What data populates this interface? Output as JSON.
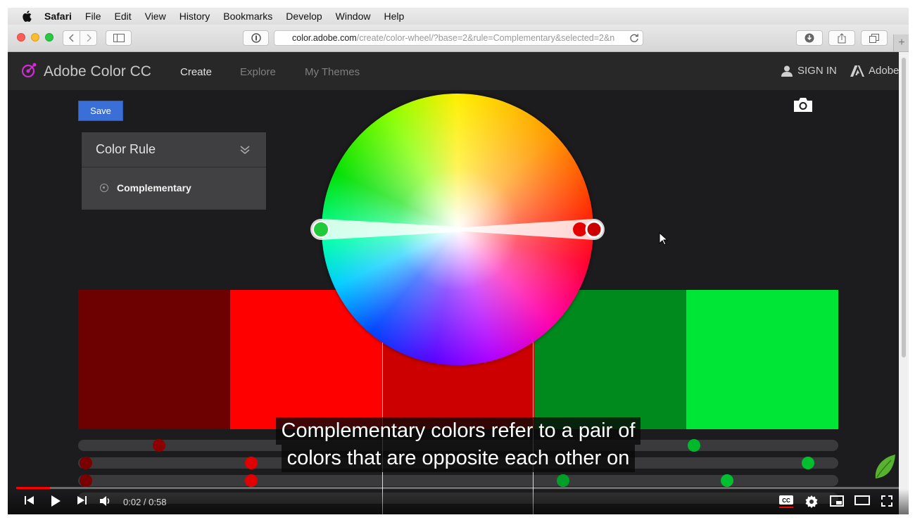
{
  "menubar": {
    "items": [
      "Safari",
      "File",
      "Edit",
      "View",
      "History",
      "Bookmarks",
      "Develop",
      "Window",
      "Help"
    ]
  },
  "browser": {
    "url_domain": "color.adobe.com",
    "url_path": "/create/color-wheel/?base=2&rule=Complementary&selected=2&n"
  },
  "app": {
    "brand": "Adobe Color CC",
    "nav": [
      "Create",
      "Explore",
      "My Themes"
    ],
    "sign_in": "SIGN IN",
    "adobe": "Adobe"
  },
  "toolbar": {
    "save_label": "Save"
  },
  "color_rule": {
    "title": "Color Rule",
    "selected": "Complementary"
  },
  "swatches": [
    "#6d0000",
    "#ff0000",
    "#cc0000",
    "#008a1e",
    "#00e637"
  ],
  "slider_knobs": [
    {
      "row": 0,
      "color": "#8c0000"
    },
    {
      "row": 0,
      "color": "#00b82c"
    },
    {
      "row": 1,
      "color": "#7a0000"
    },
    {
      "row": 1,
      "color": "#e00000"
    },
    {
      "row": 1,
      "color": "#00c030"
    },
    {
      "row": 2,
      "color": "#7a0000"
    },
    {
      "row": 2,
      "color": "#e00000"
    },
    {
      "row": 2,
      "color": "#00a028"
    },
    {
      "row": 2,
      "color": "#00c030"
    }
  ],
  "caption": {
    "line1": "Complementary colors refer to a pair of",
    "line2": "colors that are opposite each other on"
  },
  "video": {
    "time": "0:02 / 0:58",
    "progress": 0.038
  },
  "colors": {
    "accent": "#3b6fd8",
    "brand_magenta": "#d12bd5",
    "video_red": "#ff0000"
  },
  "icons": [
    "apple-icon",
    "back-icon",
    "forward-icon",
    "sidebar-icon",
    "privacy-icon",
    "reload-icon",
    "download-icon",
    "share-icon",
    "tabs-icon",
    "new-tab-icon",
    "color-logo-icon",
    "user-icon",
    "adobe-logo-icon",
    "chevron-down-icon",
    "radio-icon",
    "camera-icon",
    "cursor-icon",
    "leaf-icon",
    "skip-back-icon",
    "play-icon",
    "skip-next-icon",
    "volume-icon",
    "captions-icon",
    "settings-icon",
    "miniplayer-icon",
    "theater-icon",
    "fullscreen-icon"
  ]
}
